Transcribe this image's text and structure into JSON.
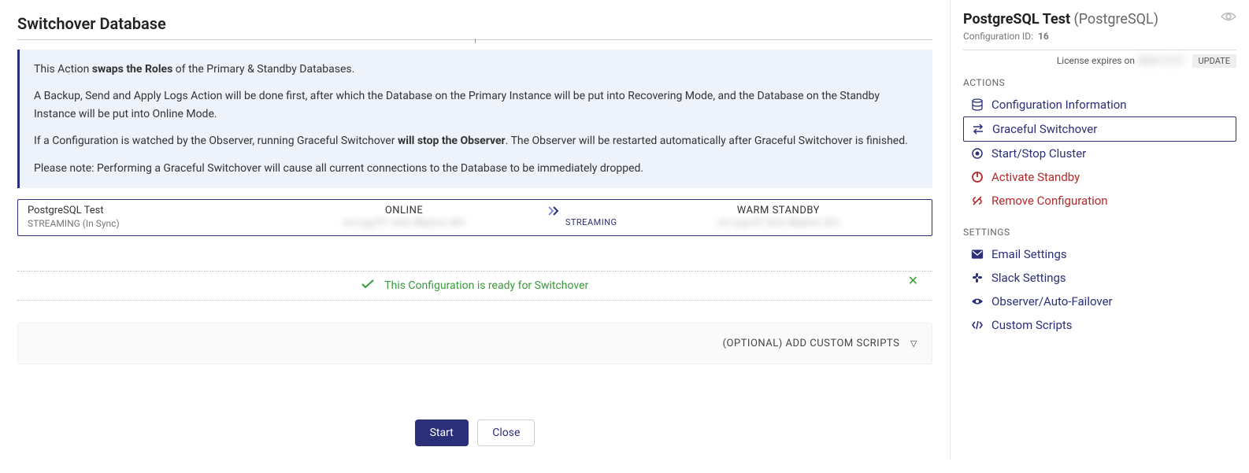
{
  "page": {
    "title": "Switchover Database"
  },
  "infobox": {
    "line1_prefix": "This Action ",
    "line1_bold": "swaps the Roles",
    "line1_suffix": " of the Primary & Standby Databases.",
    "line2": "A Backup, Send and Apply Logs Action will be done first, after which the Database on the Primary Instance will be put into Recovering Mode, and the Database on the Standby Instance will be put into Online Mode.",
    "line3_prefix": "If a Configuration is watched by the Observer, running Graceful Switchover ",
    "line3_bold": "will stop the Observer",
    "line3_suffix": ". The Observer will be restarted automatically after Graceful Switchover is finished.",
    "line4": "Please note: Performing a Graceful Switchover will cause all current connections to the Database to be immediately dropped."
  },
  "status": {
    "config_name": "PostgreSQL Test",
    "config_sub": "STREAMING (In Sync)",
    "primary_status": "ONLINE",
    "primary_host": "srv-pg-01 test.dbplus.dm",
    "stream_label": "STREAMING",
    "standby_status": "WARM STANDBY",
    "standby_host": "srv-pg-02 test.dbplus.dm"
  },
  "ready": {
    "text": "This Configuration is ready for Switchover"
  },
  "optional": {
    "label": "(OPTIONAL) ADD CUSTOM SCRIPTS"
  },
  "buttons": {
    "start": "Start",
    "close": "Close"
  },
  "sidebar": {
    "title": "PostgreSQL Test",
    "type": "(PostgreSQL)",
    "config_id_label": "Configuration ID:",
    "config_id": "16",
    "license_label": "License expires on",
    "license_date": "2024-12-31",
    "update_label": "UPDATE",
    "actions_label": "ACTIONS",
    "settings_label": "SETTINGS",
    "items": {
      "config_info": "Configuration Information",
      "graceful_switchover": "Graceful Switchover",
      "start_stop_cluster": "Start/Stop Cluster",
      "activate_standby": "Activate Standby",
      "remove_configuration": "Remove Configuration",
      "email_settings": "Email Settings",
      "slack_settings": "Slack Settings",
      "observer": "Observer/Auto-Failover",
      "custom_scripts": "Custom Scripts"
    }
  }
}
